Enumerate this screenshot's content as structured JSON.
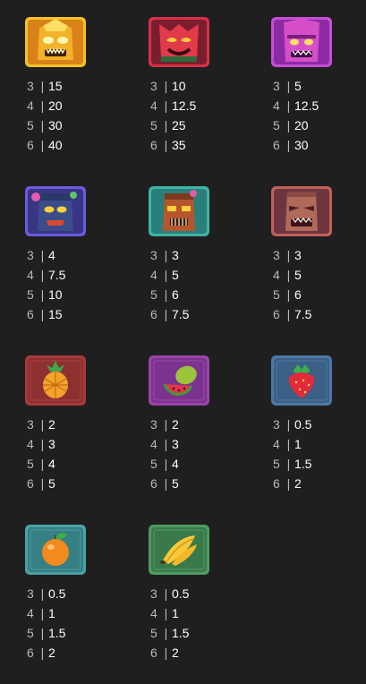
{
  "paytable": {
    "symbols": [
      {
        "icon": "gold-tiki-mask-icon",
        "frame": "#f7c224",
        "bg": "#d9821a",
        "pays": [
          {
            "count": "3",
            "value": "15"
          },
          {
            "count": "4",
            "value": "20"
          },
          {
            "count": "5",
            "value": "30"
          },
          {
            "count": "6",
            "value": "40"
          }
        ]
      },
      {
        "icon": "red-tiki-mask-icon",
        "frame": "#d8304a",
        "bg": "#b3283d",
        "pays": [
          {
            "count": "3",
            "value": "10"
          },
          {
            "count": "4",
            "value": "12.5"
          },
          {
            "count": "5",
            "value": "25"
          },
          {
            "count": "6",
            "value": "35"
          }
        ]
      },
      {
        "icon": "purple-tiki-mask-icon",
        "frame": "#c54fd3",
        "bg": "#8c2aa6",
        "pays": [
          {
            "count": "3",
            "value": "5"
          },
          {
            "count": "4",
            "value": "12.5"
          },
          {
            "count": "5",
            "value": "20"
          },
          {
            "count": "6",
            "value": "30"
          }
        ]
      },
      {
        "icon": "blue-tiki-mask-icon",
        "frame": "#6b5be0",
        "bg": "#3a3485",
        "pays": [
          {
            "count": "3",
            "value": "4"
          },
          {
            "count": "4",
            "value": "7.5"
          },
          {
            "count": "5",
            "value": "10"
          },
          {
            "count": "6",
            "value": "15"
          }
        ]
      },
      {
        "icon": "teal-tiki-mask-icon",
        "frame": "#3fb3a5",
        "bg": "#2a7f7a",
        "pays": [
          {
            "count": "3",
            "value": "3"
          },
          {
            "count": "4",
            "value": "5"
          },
          {
            "count": "5",
            "value": "6"
          },
          {
            "count": "6",
            "value": "7.5"
          }
        ]
      },
      {
        "icon": "brown-tiki-mask-icon",
        "frame": "#c0605a",
        "bg": "#6d3540",
        "pays": [
          {
            "count": "3",
            "value": "3"
          },
          {
            "count": "4",
            "value": "5"
          },
          {
            "count": "5",
            "value": "6"
          },
          {
            "count": "6",
            "value": "7.5"
          }
        ]
      },
      {
        "icon": "pineapple-icon",
        "frame": "#a83a3a",
        "bg": "#8e2f30",
        "pays": [
          {
            "count": "3",
            "value": "2"
          },
          {
            "count": "4",
            "value": "3"
          },
          {
            "count": "5",
            "value": "4"
          },
          {
            "count": "6",
            "value": "5"
          }
        ]
      },
      {
        "icon": "watermelon-icon",
        "frame": "#9a44a8",
        "bg": "#7c3390",
        "pays": [
          {
            "count": "3",
            "value": "2"
          },
          {
            "count": "4",
            "value": "3"
          },
          {
            "count": "5",
            "value": "4"
          },
          {
            "count": "6",
            "value": "5"
          }
        ]
      },
      {
        "icon": "strawberry-icon",
        "frame": "#4d78a3",
        "bg": "#3b5f85",
        "pays": [
          {
            "count": "3",
            "value": "0.5"
          },
          {
            "count": "4",
            "value": "1"
          },
          {
            "count": "5",
            "value": "1.5"
          },
          {
            "count": "6",
            "value": "2"
          }
        ]
      },
      {
        "icon": "orange-fruit-icon",
        "frame": "#4aa3a3",
        "bg": "#367f82",
        "pays": [
          {
            "count": "3",
            "value": "0.5"
          },
          {
            "count": "4",
            "value": "1"
          },
          {
            "count": "5",
            "value": "1.5"
          },
          {
            "count": "6",
            "value": "2"
          }
        ]
      },
      {
        "icon": "banana-icon",
        "frame": "#4f9a63",
        "bg": "#3a7a4a",
        "pays": [
          {
            "count": "3",
            "value": "0.5"
          },
          {
            "count": "4",
            "value": "1"
          },
          {
            "count": "5",
            "value": "1.5"
          },
          {
            "count": "6",
            "value": "2"
          }
        ]
      }
    ]
  }
}
